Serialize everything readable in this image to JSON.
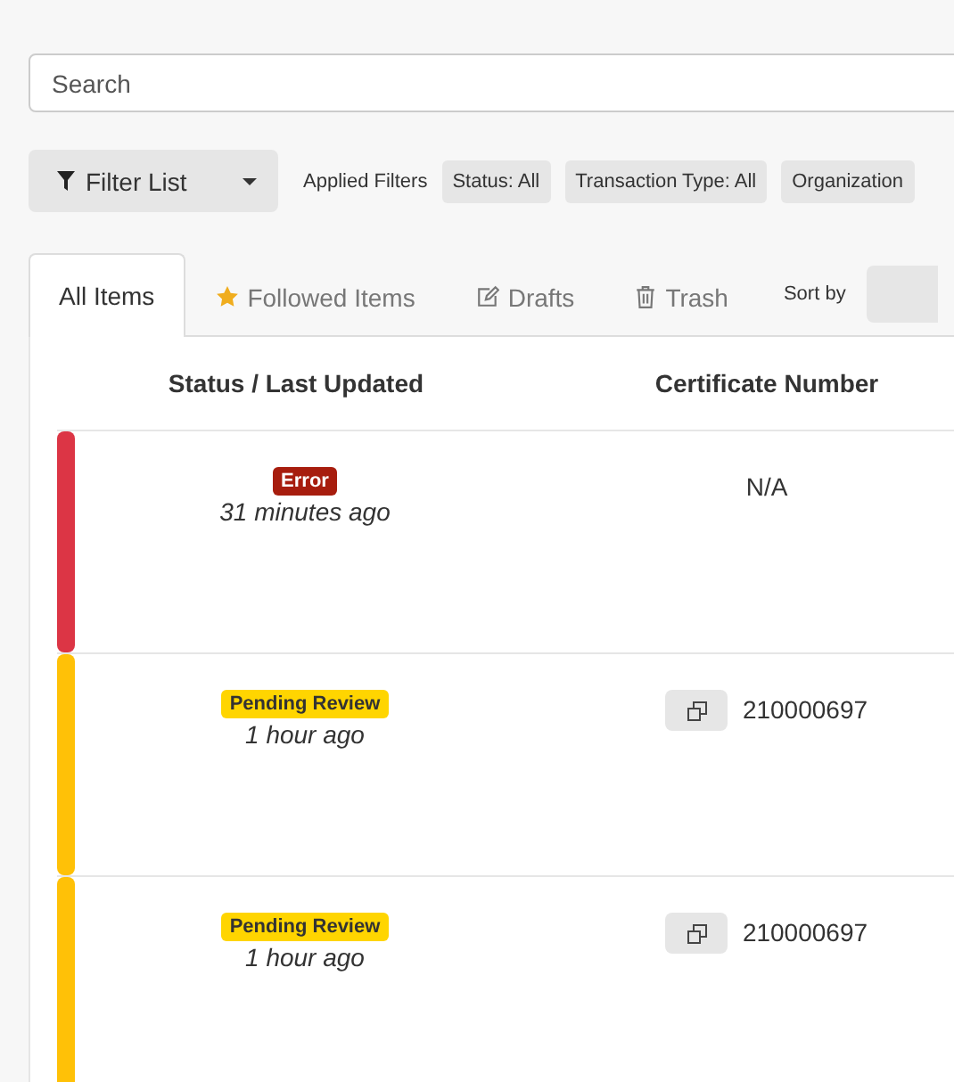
{
  "search": {
    "placeholder": "Search"
  },
  "filter_button": {
    "label": "Filter List"
  },
  "applied_filters": {
    "label": "Applied Filters",
    "chips": [
      "Status: All",
      "Transaction Type: All",
      "Organization"
    ]
  },
  "tabs": [
    {
      "label": "All Items",
      "kind": "plain",
      "selected": true
    },
    {
      "label": "Followed Items",
      "kind": "star",
      "selected": false
    },
    {
      "label": "Drafts",
      "kind": "edit",
      "selected": false
    },
    {
      "label": "Trash",
      "kind": "trash",
      "selected": false
    }
  ],
  "sort_by": {
    "label": "Sort by"
  },
  "table": {
    "columns": [
      "Status / Last Updated",
      "Certificate Number"
    ],
    "rows": [
      {
        "status": "Error",
        "kind": "error",
        "color": "#dc3545",
        "updated": "31 minutes ago",
        "certificate": "N/A",
        "copyable": false
      },
      {
        "status": "Pending Review",
        "kind": "pending",
        "color": "#ffc107",
        "updated": "1 hour ago",
        "certificate": "210000697",
        "copyable": true
      },
      {
        "status": "Pending Review",
        "kind": "pending",
        "color": "#ffc107",
        "updated": "1 hour ago",
        "certificate": "210000697",
        "copyable": true
      }
    ]
  }
}
